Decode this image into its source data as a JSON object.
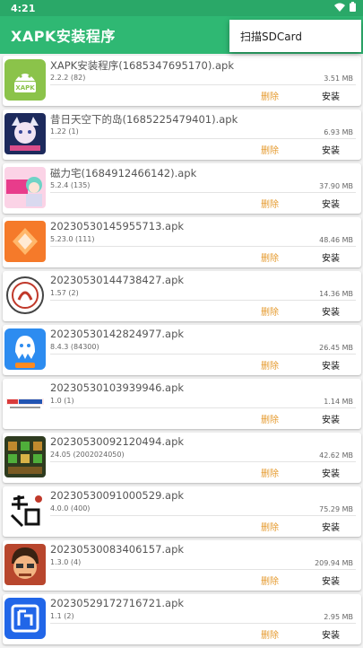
{
  "status_bar": {
    "time": "4:21"
  },
  "app_bar": {
    "title": "XAPK安装程序"
  },
  "popup_menu": {
    "items": [
      {
        "label": "扫描SDCard"
      }
    ]
  },
  "buttons": {
    "delete_label": "删除",
    "install_label": "安装"
  },
  "colors": {
    "primary": "#2fb873",
    "status_bar": "#2aa868",
    "delete": "#e59a2e"
  },
  "apps": [
    {
      "name": "XAPK安装程序(1685347695170).apk",
      "version": "2.2.2 (82)",
      "size": "3.51 MB",
      "icon": "android-xapk-icon"
    },
    {
      "name": "昔日天空下的岛(1685225479401).apk",
      "version": "1.22 (1)",
      "size": "6.93 MB",
      "icon": "cat-girl-game-icon"
    },
    {
      "name": "磁力宅(1684912466142).apk",
      "version": "5.2.4 (135)",
      "size": "37.90 MB",
      "icon": "anime-girl-icon"
    },
    {
      "name": "20230530145955713.apk",
      "version": "5.23.0 (111)",
      "size": "48.46 MB",
      "icon": "orange-cube-icon"
    },
    {
      "name": "20230530144738427.apk",
      "version": "1.57 (2)",
      "size": "14.36 MB",
      "icon": "seal-emblem-icon"
    },
    {
      "name": "20230530142824977.apk",
      "version": "8.4.3 (84300)",
      "size": "26.45 MB",
      "icon": "octopus-app-icon"
    },
    {
      "name": "20230530103939946.apk",
      "version": "1.0 (1)",
      "size": "1.14 MB",
      "icon": "manhua-logo-icon"
    },
    {
      "name": "20230530092120494.apk",
      "version": "24.05 (2002024050)",
      "size": "42.62 MB",
      "icon": "pixel-game-icon"
    },
    {
      "name": "20230530091000529.apk",
      "version": "4.0.0 (400)",
      "size": "75.29 MB",
      "icon": "calligraphy-icon"
    },
    {
      "name": "20230530083406157.apk",
      "version": "1.3.0 (4)",
      "size": "209.94 MB",
      "icon": "cartoon-man-icon"
    },
    {
      "name": "20230529172716721.apk",
      "version": "1.1 (2)",
      "size": "2.95 MB",
      "icon": "blue-frame-icon"
    }
  ]
}
